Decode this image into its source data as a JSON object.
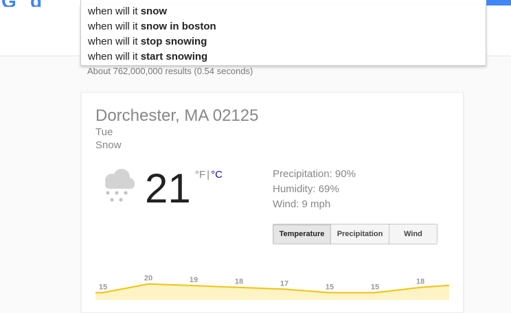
{
  "suggestions": [
    {
      "prefix": "when will it ",
      "bold": "snow"
    },
    {
      "prefix": "when will it ",
      "bold": "snow in boston"
    },
    {
      "prefix": "when will it ",
      "bold": "stop snowing"
    },
    {
      "prefix": "when will it ",
      "bold": "start snowing"
    }
  ],
  "results_count": "About 762,000,000 results (0.54 seconds)",
  "weather": {
    "location": "Dorchester, MA 02125",
    "day": "Tue",
    "condition": "Snow",
    "temperature": "21",
    "unit_f": "°F",
    "unit_sep": "|",
    "unit_c": "°C",
    "precipitation": "Precipitation: 90%",
    "humidity": "Humidity: 69%",
    "wind": "Wind: 9 mph",
    "icon": "snow-cloud-icon"
  },
  "tabs": [
    {
      "label": "Temperature",
      "active": true
    },
    {
      "label": "Precipitation",
      "active": false
    },
    {
      "label": "Wind",
      "active": false
    }
  ],
  "colors": {
    "accent_blue": "#4285f4",
    "link_blue": "#1a0dab",
    "chart_line": "#f4c20d",
    "chart_fill": "#fdf3c4",
    "muted_text": "#878787"
  },
  "chart_data": {
    "type": "area",
    "values": [
      15,
      20,
      19,
      18,
      17,
      15,
      15,
      18
    ],
    "labels": [
      "15",
      "20",
      "19",
      "18",
      "17",
      "15",
      "15",
      "18"
    ],
    "ylabel": "",
    "xlabel": ""
  }
}
